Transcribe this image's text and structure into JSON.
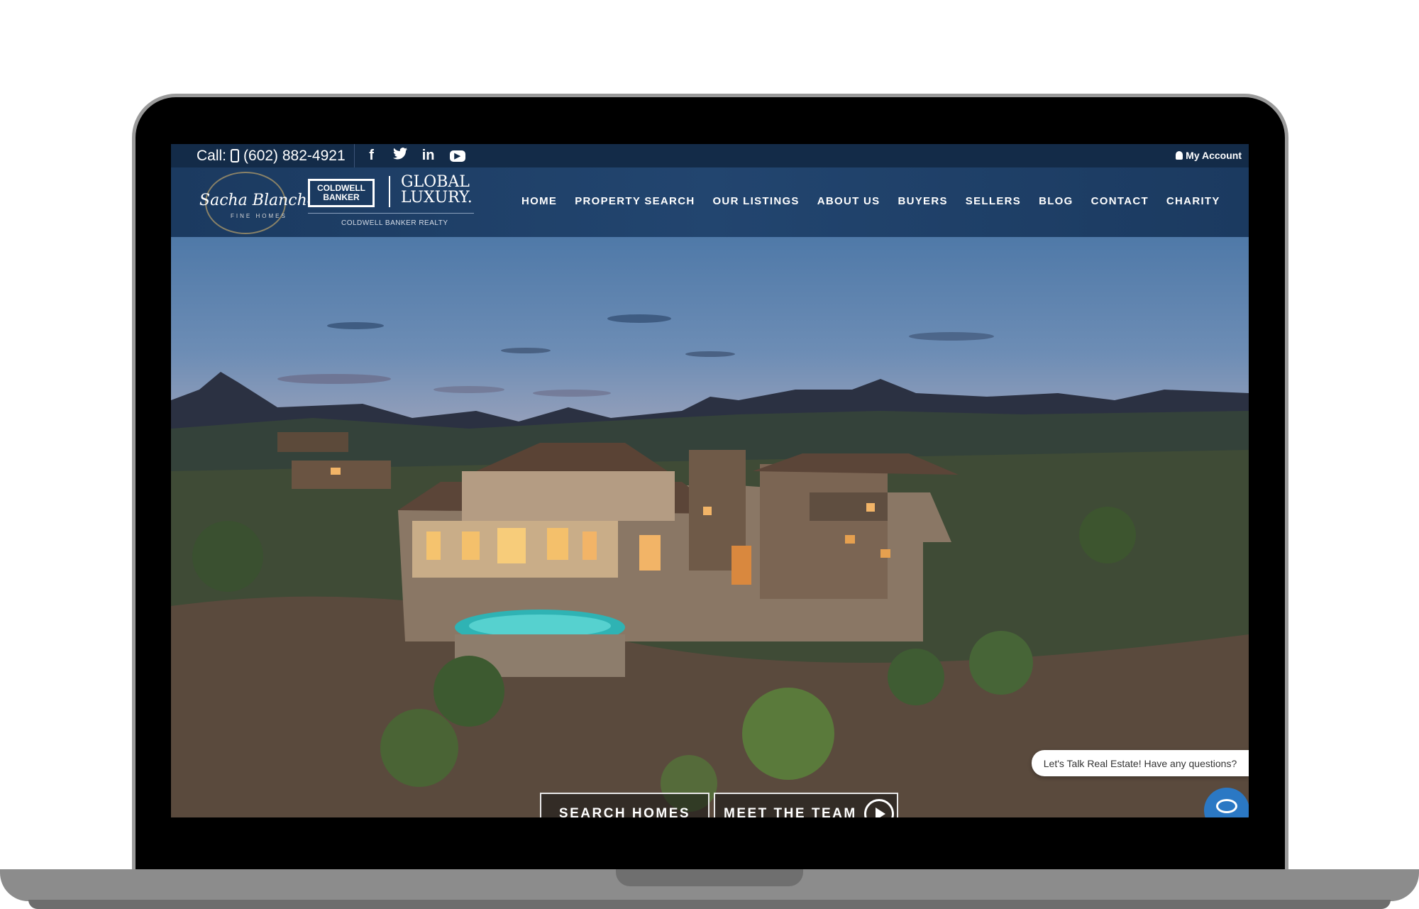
{
  "topbar": {
    "call_label": "Call:",
    "phone": "(602) 882-4921",
    "social_icons": [
      "facebook-icon",
      "twitter-icon",
      "linkedin-icon",
      "youtube-icon"
    ],
    "account": "My Account"
  },
  "logo": {
    "name": "Sacha Blanchet",
    "tag": "FINE HOMES",
    "cb_line1": "COLDWELL",
    "cb_line2": "BANKER",
    "global": "GLOBAL",
    "luxury": "LUXURY.",
    "cbr": "COLDWELL BANKER REALTY"
  },
  "nav": [
    "HOME",
    "PROPERTY SEARCH",
    "OUR LISTINGS",
    "ABOUT US",
    "BUYERS",
    "SELLERS",
    "BLOG",
    "CONTACT",
    "CHARITY"
  ],
  "hero": {
    "search_button": "SEARCH HOMES",
    "team_button": "MEET THE TEAM"
  },
  "chat": {
    "prompt": "Let's Talk Real Estate! Have any questions?"
  },
  "colors": {
    "header_bg": "#1b3a60",
    "topbar_bg": "#132b48",
    "chat_blue": "#2b78c4",
    "gold_accent": "#b8a06a"
  }
}
